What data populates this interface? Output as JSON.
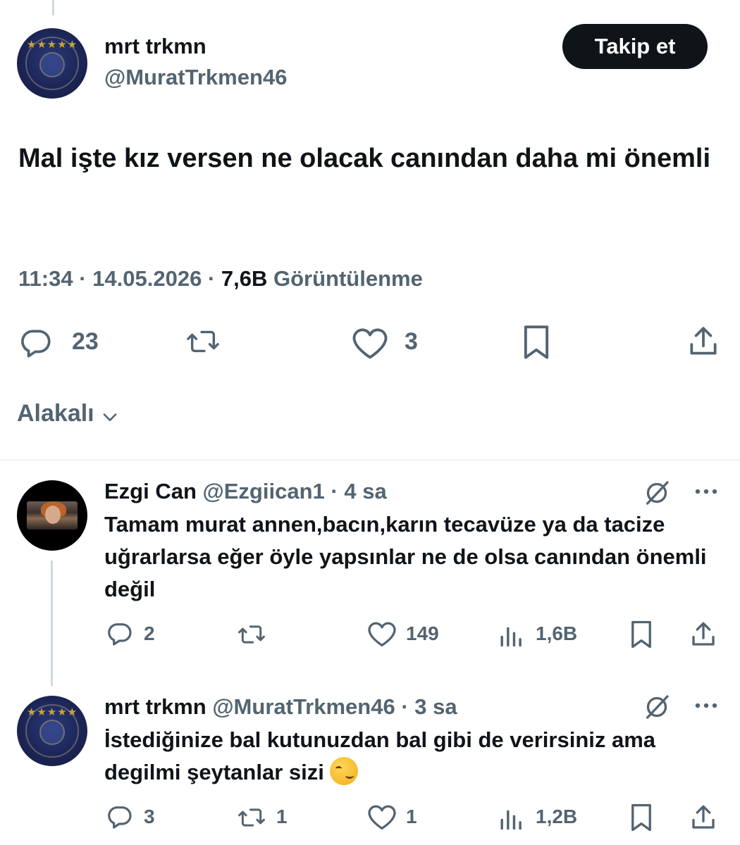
{
  "main_tweet": {
    "author": {
      "name": "mrt trkmn",
      "handle": "@MuratTrkmen46"
    },
    "follow_label": "Takip et",
    "text": "Mal işte kız versen ne olacak canından daha mi önemli",
    "time": "11:34",
    "date": "14.05.2026",
    "views_count": "7,6B",
    "views_label": "Görüntülenme",
    "separator": "·",
    "actions": {
      "replies": "23",
      "likes": "3"
    }
  },
  "sort": {
    "label": "Alakalı"
  },
  "replies": [
    {
      "name": "Ezgi Can",
      "handle": "@Ezgiican1",
      "time": "4 sa",
      "text": "Tamam murat annen,bacın,karın tecavüze ya da tacize uğrarlarsa eğer öyle yapsınlar ne de olsa canından önemli değil",
      "replies": "2",
      "retweets": "",
      "likes": "149",
      "views": "1,6B"
    },
    {
      "name": "mrt trkmn",
      "handle": "@MuratTrkmen46",
      "time": "3 sa",
      "text": "İstediğinize bal kutunuzdan bal gibi de verirsiniz ama degilmi şeytanlar sizi",
      "replies": "3",
      "retweets": "1",
      "likes": "1",
      "views": "1,2B"
    }
  ],
  "icons": {
    "reply": "reply-icon",
    "retweet": "retweet-icon",
    "like": "heart-icon",
    "bookmark": "bookmark-icon",
    "share": "share-icon",
    "views": "views-icon",
    "grok": "grok-icon",
    "more": "more-icon",
    "chevron": "chevron-down-icon",
    "emoji": "smirking-face-emoji"
  },
  "colors": {
    "text": "#0f1419",
    "secondary": "#536471",
    "button_bg": "#0f1419",
    "divider": "#eff3f4",
    "thread_line": "#cfd9de"
  }
}
